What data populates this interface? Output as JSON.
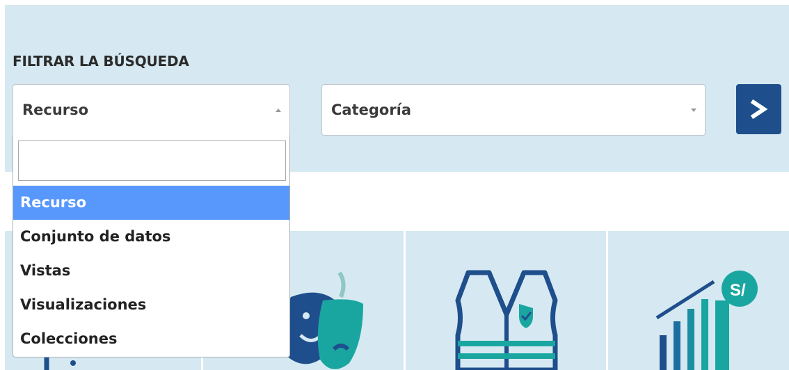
{
  "filter": {
    "heading": "FILTRAR LA BÚSQUEDA",
    "resource_select": {
      "value": "Recurso",
      "expanded": true,
      "search_value": "",
      "options": [
        "Recurso",
        "Conjunto de datos",
        "Vistas",
        "Visualizaciones",
        "Colecciones"
      ],
      "highlighted_option": "Recurso"
    },
    "category_select": {
      "value": "Categoría"
    },
    "submit_icon": "chevron-right-icon"
  },
  "tiles": [
    {
      "icon": "document-icon"
    },
    {
      "icon": "theater-masks-icon"
    },
    {
      "icon": "safety-vest-icon"
    },
    {
      "icon": "growth-chart-currency-icon"
    }
  ],
  "colors": {
    "panel_background": "#d6e9f2",
    "button_background": "#1f4e8c",
    "highlight": "#5897fb",
    "icon_dark": "#1f4e8c",
    "icon_teal": "#1aa6a0"
  }
}
